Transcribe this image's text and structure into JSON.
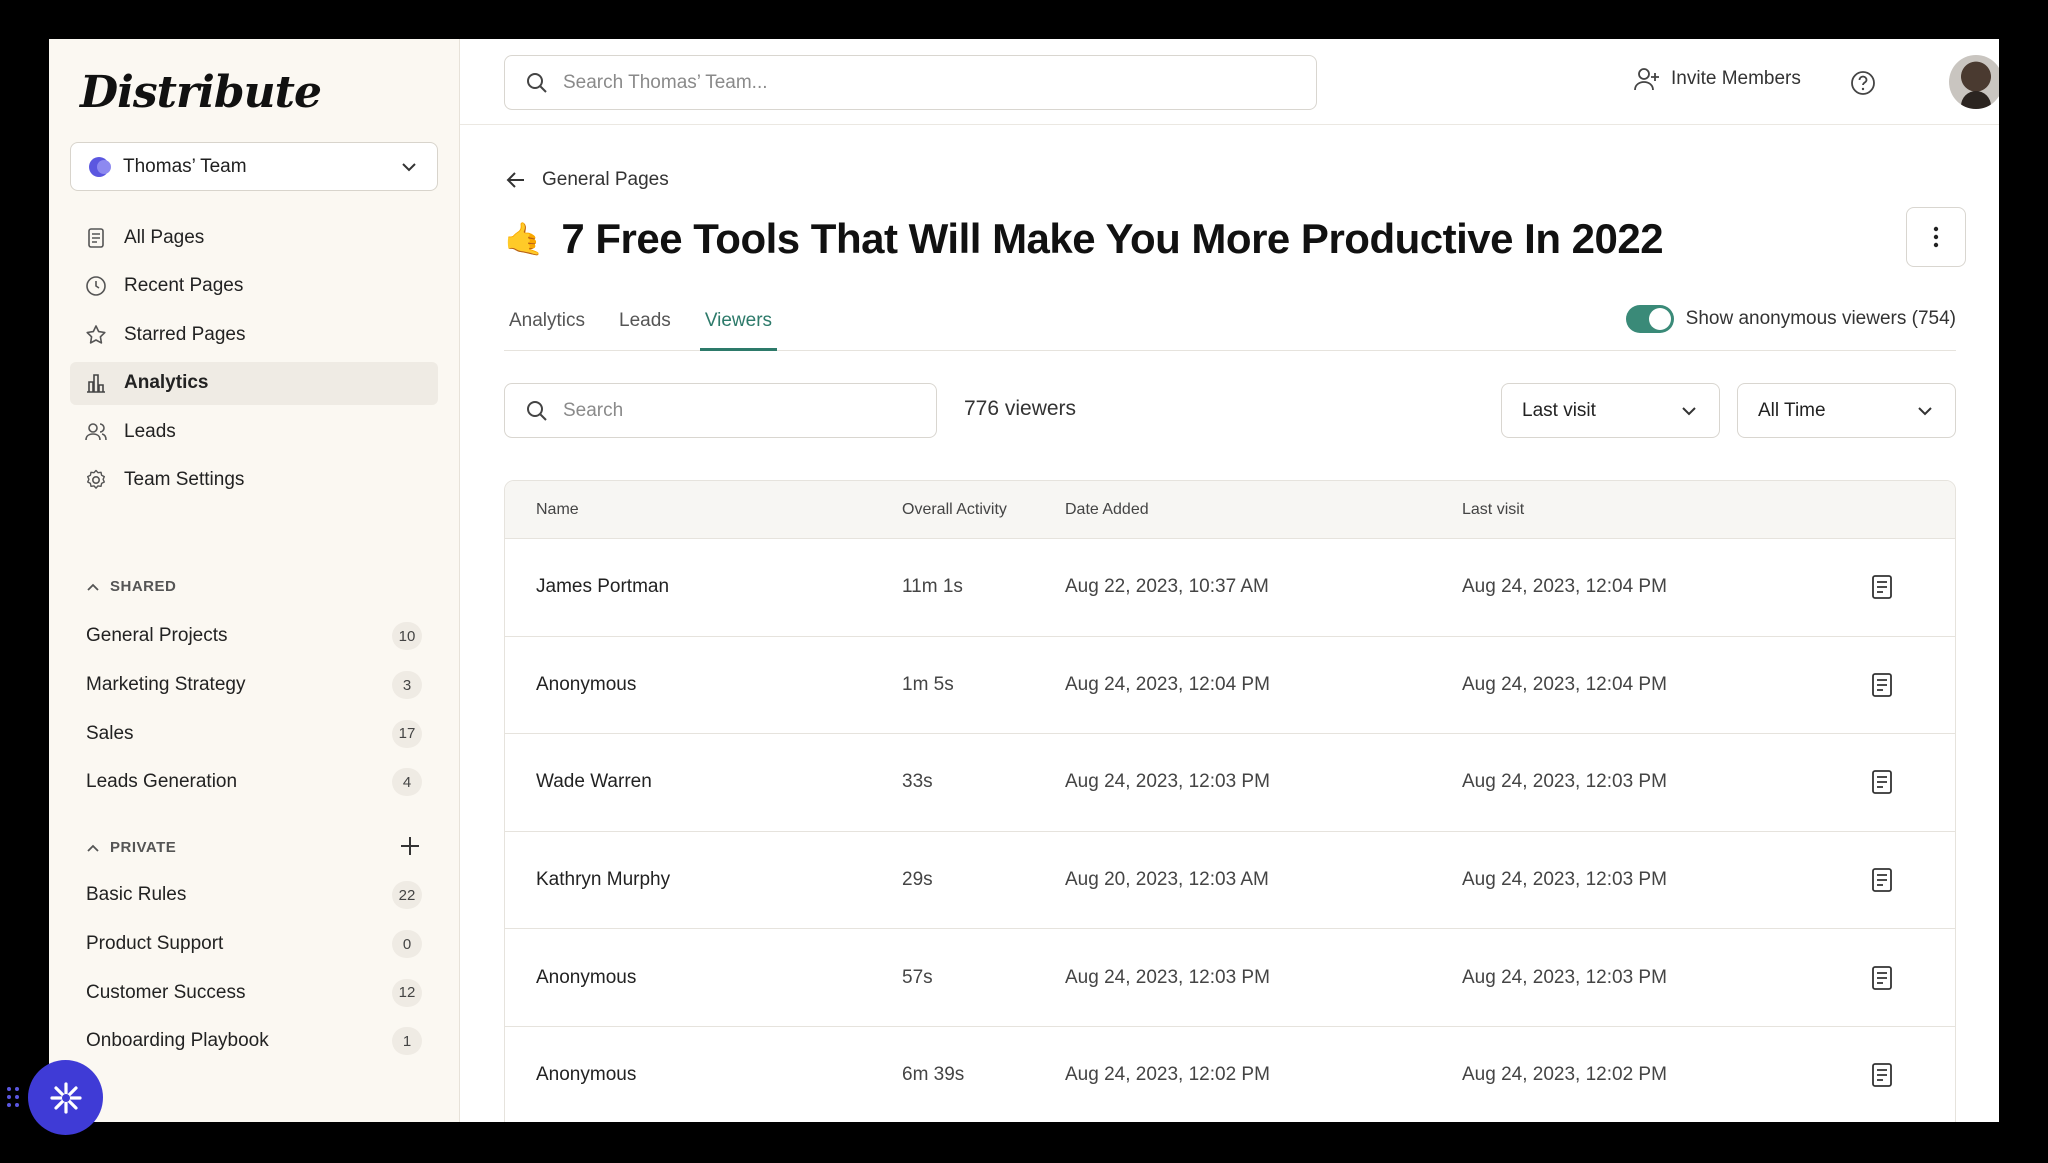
{
  "sidebar": {
    "logo": "Distribute",
    "team": "Thomas’ Team",
    "nav": [
      {
        "label": "All Pages",
        "icon": "document-icon"
      },
      {
        "label": "Recent Pages",
        "icon": "clock-icon"
      },
      {
        "label": "Starred Pages",
        "icon": "star-icon"
      },
      {
        "label": "Analytics",
        "icon": "bar-chart-icon",
        "active": true
      },
      {
        "label": "Leads",
        "icon": "users-icon"
      },
      {
        "label": "Team Settings",
        "icon": "gear-icon"
      }
    ],
    "shared": {
      "heading": "SHARED",
      "items": [
        {
          "label": "General Projects",
          "count": "10"
        },
        {
          "label": "Marketing Strategy",
          "count": "3"
        },
        {
          "label": "Sales",
          "count": "17"
        },
        {
          "label": "Leads Generation",
          "count": "4"
        }
      ]
    },
    "private": {
      "heading": "PRIVATE",
      "items": [
        {
          "label": "Basic Rules",
          "count": "22"
        },
        {
          "label": "Product Support",
          "count": "0"
        },
        {
          "label": "Customer Success",
          "count": "12"
        },
        {
          "label": "Onboarding Playbook",
          "count": "1"
        }
      ]
    }
  },
  "topbar": {
    "search_placeholder": "Search Thomas’ Team...",
    "invite_label": "Invite Members"
  },
  "page": {
    "back_label": "General Pages",
    "emoji": "🤙",
    "title": "7 Free Tools That Will Make You More Productive In 2022",
    "tabs": [
      "Analytics",
      "Leads",
      "Viewers"
    ],
    "active_tab": "Viewers",
    "anon_label": "Show anonymous viewers (754)",
    "search_placeholder": "Search",
    "viewer_count": "776 viewers",
    "sort_value": "Last visit",
    "range_value": "All Time"
  },
  "table": {
    "columns": [
      "Name",
      "Overall Activity",
      "Date Added",
      "Last visit"
    ],
    "rows": [
      {
        "name": "James Portman",
        "activity": "11m 1s",
        "added": "Aug 22, 2023, 10:37 AM",
        "last": "Aug 24, 2023, 12:04 PM"
      },
      {
        "name": "Anonymous",
        "activity": "1m 5s",
        "added": "Aug 24, 2023, 12:04 PM",
        "last": "Aug 24, 2023, 12:04 PM"
      },
      {
        "name": "Wade Warren",
        "activity": "33s",
        "added": "Aug 24, 2023, 12:03 PM",
        "last": "Aug 24, 2023, 12:03 PM"
      },
      {
        "name": "Kathryn Murphy",
        "activity": "29s",
        "added": "Aug 20, 2023, 12:03 AM",
        "last": "Aug 24, 2023, 12:03 PM"
      },
      {
        "name": "Anonymous",
        "activity": "57s",
        "added": "Aug 24, 2023, 12:03 PM",
        "last": "Aug 24, 2023, 12:03 PM"
      },
      {
        "name": "Anonymous",
        "activity": "6m 39s",
        "added": "Aug 24, 2023, 12:02 PM",
        "last": "Aug 24, 2023, 12:02 PM"
      }
    ]
  }
}
